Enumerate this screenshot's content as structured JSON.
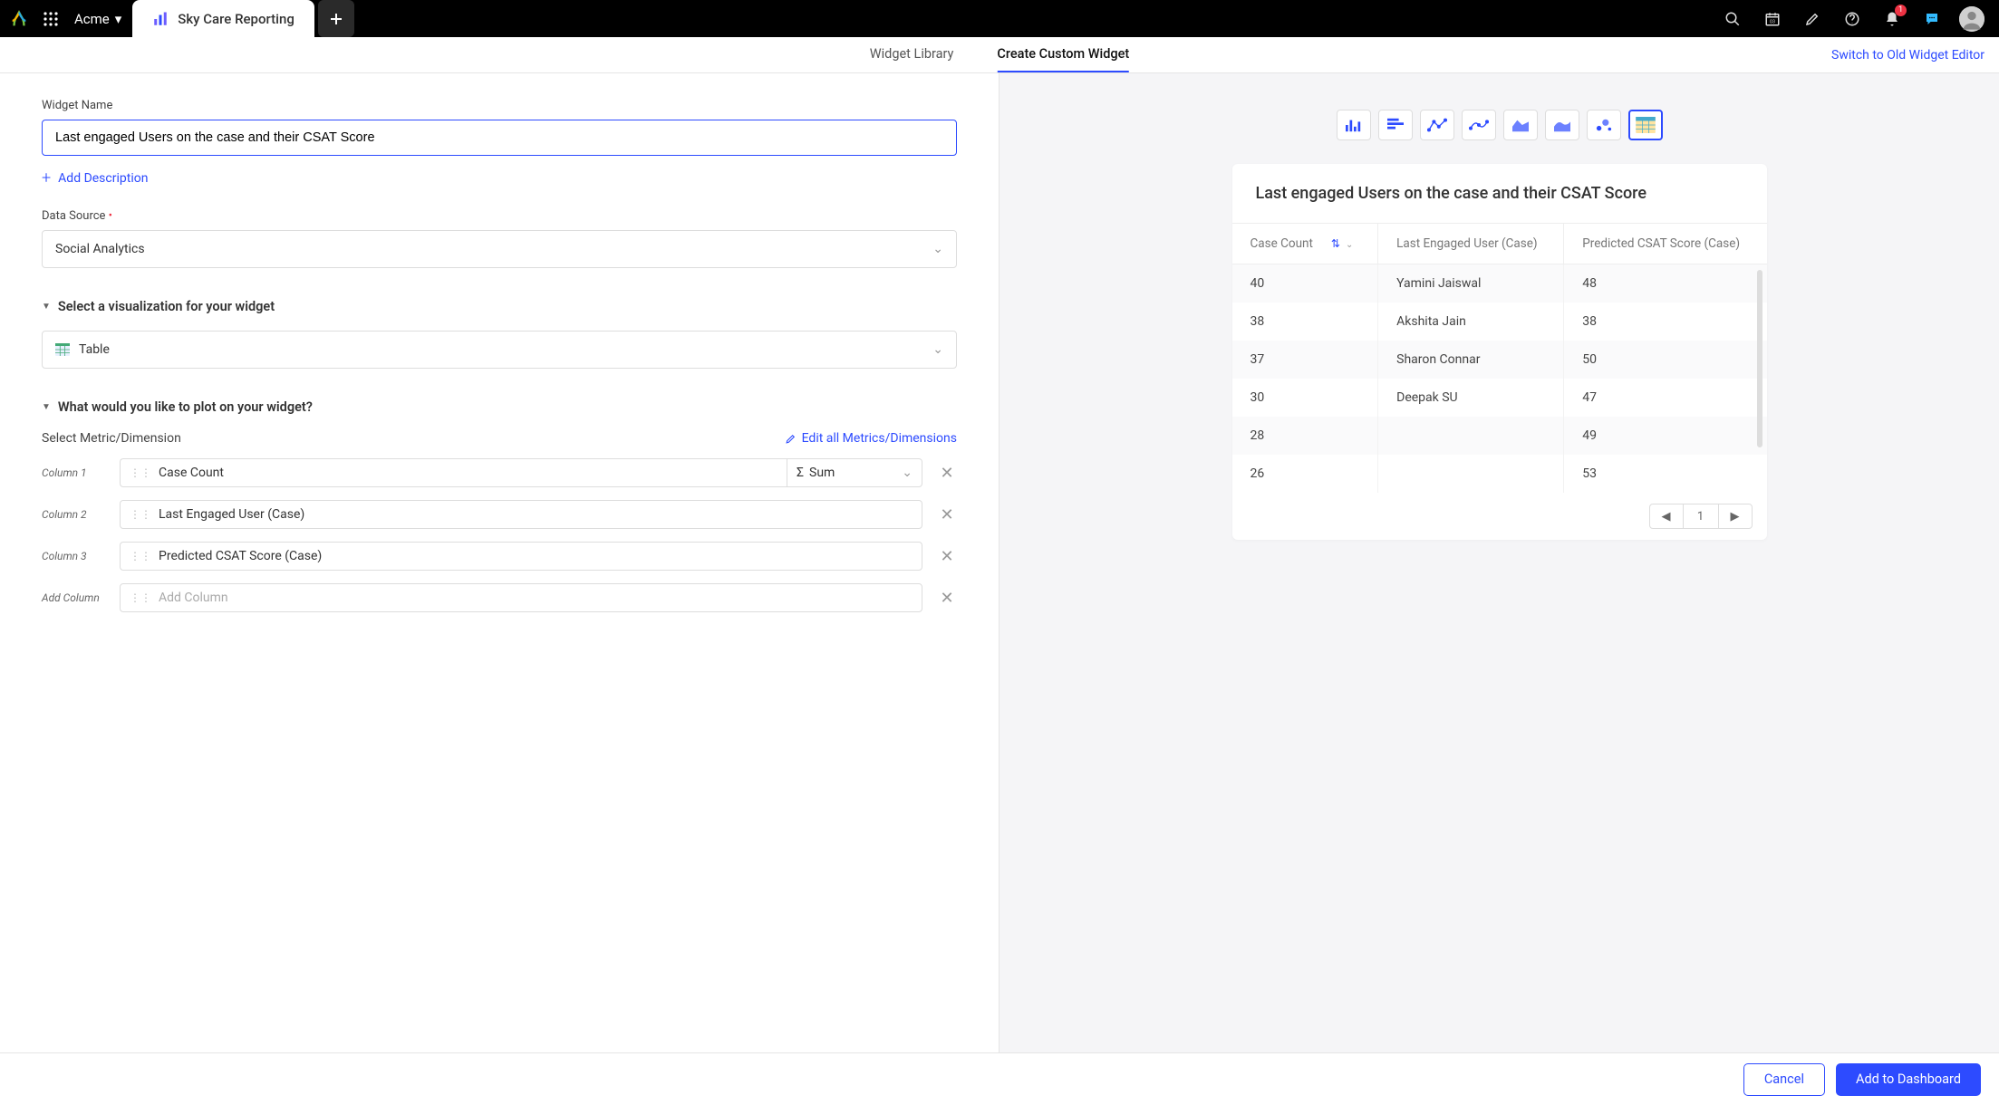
{
  "workspace": "Acme",
  "tab_title": "Sky Care Reporting",
  "notif_count": "1",
  "subtabs": {
    "library": "Widget Library",
    "create": "Create Custom Widget",
    "switch": "Switch to Old Widget Editor"
  },
  "form": {
    "name_label": "Widget Name",
    "name_value": "Last engaged Users on the case and their CSAT Score",
    "add_desc": "Add Description",
    "ds_label": "Data Source",
    "ds_value": "Social Analytics",
    "viz_header": "Select a visualization for your widget",
    "viz_value": "Table",
    "plot_header": "What would you like to plot on your widget?",
    "metrics_label": "Select Metric/Dimension",
    "edit_metrics": "Edit all Metrics/Dimensions",
    "col1_label": "Column 1",
    "col1_value": "Case Count",
    "col1_agg": "Sum",
    "col2_label": "Column 2",
    "col2_value": "Last Engaged User (Case)",
    "col3_label": "Column 3",
    "col3_value": "Predicted CSAT Score (Case)",
    "addcol_label": "Add Column",
    "addcol_placeholder": "Add Column"
  },
  "preview": {
    "title": "Last engaged Users on the case and their CSAT Score",
    "h1": "Case Count",
    "h2": "Last Engaged User (Case)",
    "h3": "Predicted CSAT Score (Case)",
    "rows": [
      {
        "c": "40",
        "u": "Yamini Jaiswal",
        "s": "48"
      },
      {
        "c": "38",
        "u": "Akshita Jain",
        "s": "38"
      },
      {
        "c": "37",
        "u": "Sharon Connar",
        "s": "50"
      },
      {
        "c": "30",
        "u": "Deepak SU",
        "s": "47"
      },
      {
        "c": "28",
        "u": "",
        "s": "49"
      },
      {
        "c": "26",
        "u": "",
        "s": "53"
      }
    ],
    "page": "1"
  },
  "footer": {
    "cancel": "Cancel",
    "add": "Add to Dashboard"
  },
  "chart_data": {
    "type": "table",
    "title": "Last engaged Users on the case and their CSAT Score",
    "columns": [
      "Case Count",
      "Last Engaged User (Case)",
      "Predicted CSAT Score (Case)"
    ],
    "rows": [
      [
        40,
        "Yamini Jaiswal",
        48
      ],
      [
        38,
        "Akshita Jain",
        38
      ],
      [
        37,
        "Sharon Connar",
        50
      ],
      [
        30,
        "Deepak SU",
        47
      ],
      [
        28,
        "",
        49
      ],
      [
        26,
        "",
        53
      ]
    ]
  }
}
